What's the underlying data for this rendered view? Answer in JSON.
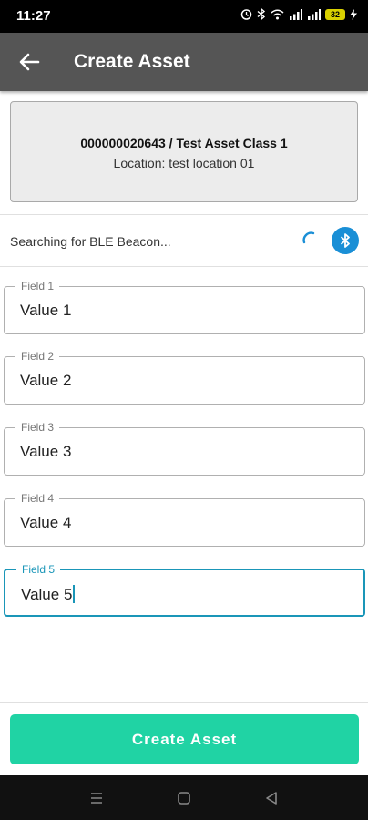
{
  "status_bar": {
    "time": "11:27",
    "battery_level": "32",
    "icons": [
      "alarm-icon",
      "bluetooth-icon",
      "wifi-icon",
      "signal-icon",
      "signal-icon",
      "battery-icon",
      "charging-icon"
    ]
  },
  "app_bar": {
    "title": "Create Asset",
    "back_icon": "back-arrow-icon"
  },
  "asset": {
    "name": "000000020643 / Test Asset Class 1",
    "location": "Location: test location 01"
  },
  "ble": {
    "status": "Searching for BLE Beacon...",
    "spinner_icon": "loading-spinner-icon",
    "button_icon": "bluetooth-icon"
  },
  "fields": [
    {
      "label": "Field 1",
      "value": "Value 1",
      "focused": false
    },
    {
      "label": "Field 2",
      "value": "Value 2",
      "focused": false
    },
    {
      "label": "Field 3",
      "value": "Value 3",
      "focused": false
    },
    {
      "label": "Field 4",
      "value": "Value 4",
      "focused": false
    },
    {
      "label": "Field 5",
      "value": "Value 5",
      "focused": true
    }
  ],
  "actions": {
    "create_label": "Create Asset"
  },
  "nav_bar": {
    "icons": [
      "menu-icon",
      "home-icon",
      "back-icon"
    ]
  },
  "colors": {
    "app_bar": "#555555",
    "accent": "#1a96b8",
    "button": "#20d3a4",
    "bluetooth": "#1a8fd6"
  }
}
